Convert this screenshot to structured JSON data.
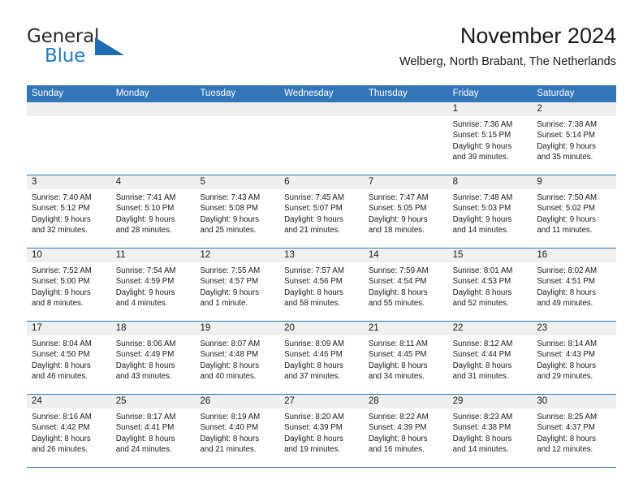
{
  "brand": {
    "name_top": "General",
    "name_bottom": "Blue",
    "accent_color": "#1f7ac4",
    "triangle_color": "#1f6cb0"
  },
  "header": {
    "title": "November 2024",
    "subtitle": "Welberg, North Brabant, The Netherlands"
  },
  "theme": {
    "header_blue": "#3275b8",
    "day_strip_gray": "#efefef",
    "text_color": "#1a1a1a"
  },
  "calendar": {
    "weekdays": [
      "Sunday",
      "Monday",
      "Tuesday",
      "Wednesday",
      "Thursday",
      "Friday",
      "Saturday"
    ],
    "weeks": [
      [
        {
          "day": "",
          "lines": []
        },
        {
          "day": "",
          "lines": []
        },
        {
          "day": "",
          "lines": []
        },
        {
          "day": "",
          "lines": []
        },
        {
          "day": "",
          "lines": []
        },
        {
          "day": "1",
          "lines": [
            "Sunrise: 7:36 AM",
            "Sunset: 5:15 PM",
            "Daylight: 9 hours",
            "and 39 minutes."
          ]
        },
        {
          "day": "2",
          "lines": [
            "Sunrise: 7:38 AM",
            "Sunset: 5:14 PM",
            "Daylight: 9 hours",
            "and 35 minutes."
          ]
        }
      ],
      [
        {
          "day": "3",
          "lines": [
            "Sunrise: 7:40 AM",
            "Sunset: 5:12 PM",
            "Daylight: 9 hours",
            "and 32 minutes."
          ]
        },
        {
          "day": "4",
          "lines": [
            "Sunrise: 7:41 AM",
            "Sunset: 5:10 PM",
            "Daylight: 9 hours",
            "and 28 minutes."
          ]
        },
        {
          "day": "5",
          "lines": [
            "Sunrise: 7:43 AM",
            "Sunset: 5:08 PM",
            "Daylight: 9 hours",
            "and 25 minutes."
          ]
        },
        {
          "day": "6",
          "lines": [
            "Sunrise: 7:45 AM",
            "Sunset: 5:07 PM",
            "Daylight: 9 hours",
            "and 21 minutes."
          ]
        },
        {
          "day": "7",
          "lines": [
            "Sunrise: 7:47 AM",
            "Sunset: 5:05 PM",
            "Daylight: 9 hours",
            "and 18 minutes."
          ]
        },
        {
          "day": "8",
          "lines": [
            "Sunrise: 7:48 AM",
            "Sunset: 5:03 PM",
            "Daylight: 9 hours",
            "and 14 minutes."
          ]
        },
        {
          "day": "9",
          "lines": [
            "Sunrise: 7:50 AM",
            "Sunset: 5:02 PM",
            "Daylight: 9 hours",
            "and 11 minutes."
          ]
        }
      ],
      [
        {
          "day": "10",
          "lines": [
            "Sunrise: 7:52 AM",
            "Sunset: 5:00 PM",
            "Daylight: 9 hours",
            "and 8 minutes."
          ]
        },
        {
          "day": "11",
          "lines": [
            "Sunrise: 7:54 AM",
            "Sunset: 4:59 PM",
            "Daylight: 9 hours",
            "and 4 minutes."
          ]
        },
        {
          "day": "12",
          "lines": [
            "Sunrise: 7:55 AM",
            "Sunset: 4:57 PM",
            "Daylight: 9 hours",
            "and 1 minute."
          ]
        },
        {
          "day": "13",
          "lines": [
            "Sunrise: 7:57 AM",
            "Sunset: 4:56 PM",
            "Daylight: 8 hours",
            "and 58 minutes."
          ]
        },
        {
          "day": "14",
          "lines": [
            "Sunrise: 7:59 AM",
            "Sunset: 4:54 PM",
            "Daylight: 8 hours",
            "and 55 minutes."
          ]
        },
        {
          "day": "15",
          "lines": [
            "Sunrise: 8:01 AM",
            "Sunset: 4:53 PM",
            "Daylight: 8 hours",
            "and 52 minutes."
          ]
        },
        {
          "day": "16",
          "lines": [
            "Sunrise: 8:02 AM",
            "Sunset: 4:51 PM",
            "Daylight: 8 hours",
            "and 49 minutes."
          ]
        }
      ],
      [
        {
          "day": "17",
          "lines": [
            "Sunrise: 8:04 AM",
            "Sunset: 4:50 PM",
            "Daylight: 8 hours",
            "and 46 minutes."
          ]
        },
        {
          "day": "18",
          "lines": [
            "Sunrise: 8:06 AM",
            "Sunset: 4:49 PM",
            "Daylight: 8 hours",
            "and 43 minutes."
          ]
        },
        {
          "day": "19",
          "lines": [
            "Sunrise: 8:07 AM",
            "Sunset: 4:48 PM",
            "Daylight: 8 hours",
            "and 40 minutes."
          ]
        },
        {
          "day": "20",
          "lines": [
            "Sunrise: 8:09 AM",
            "Sunset: 4:46 PM",
            "Daylight: 8 hours",
            "and 37 minutes."
          ]
        },
        {
          "day": "21",
          "lines": [
            "Sunrise: 8:11 AM",
            "Sunset: 4:45 PM",
            "Daylight: 8 hours",
            "and 34 minutes."
          ]
        },
        {
          "day": "22",
          "lines": [
            "Sunrise: 8:12 AM",
            "Sunset: 4:44 PM",
            "Daylight: 8 hours",
            "and 31 minutes."
          ]
        },
        {
          "day": "23",
          "lines": [
            "Sunrise: 8:14 AM",
            "Sunset: 4:43 PM",
            "Daylight: 8 hours",
            "and 29 minutes."
          ]
        }
      ],
      [
        {
          "day": "24",
          "lines": [
            "Sunrise: 8:16 AM",
            "Sunset: 4:42 PM",
            "Daylight: 8 hours",
            "and 26 minutes."
          ]
        },
        {
          "day": "25",
          "lines": [
            "Sunrise: 8:17 AM",
            "Sunset: 4:41 PM",
            "Daylight: 8 hours",
            "and 24 minutes."
          ]
        },
        {
          "day": "26",
          "lines": [
            "Sunrise: 8:19 AM",
            "Sunset: 4:40 PM",
            "Daylight: 8 hours",
            "and 21 minutes."
          ]
        },
        {
          "day": "27",
          "lines": [
            "Sunrise: 8:20 AM",
            "Sunset: 4:39 PM",
            "Daylight: 8 hours",
            "and 19 minutes."
          ]
        },
        {
          "day": "28",
          "lines": [
            "Sunrise: 8:22 AM",
            "Sunset: 4:39 PM",
            "Daylight: 8 hours",
            "and 16 minutes."
          ]
        },
        {
          "day": "29",
          "lines": [
            "Sunrise: 8:23 AM",
            "Sunset: 4:38 PM",
            "Daylight: 8 hours",
            "and 14 minutes."
          ]
        },
        {
          "day": "30",
          "lines": [
            "Sunrise: 8:25 AM",
            "Sunset: 4:37 PM",
            "Daylight: 8 hours",
            "and 12 minutes."
          ]
        }
      ]
    ]
  }
}
